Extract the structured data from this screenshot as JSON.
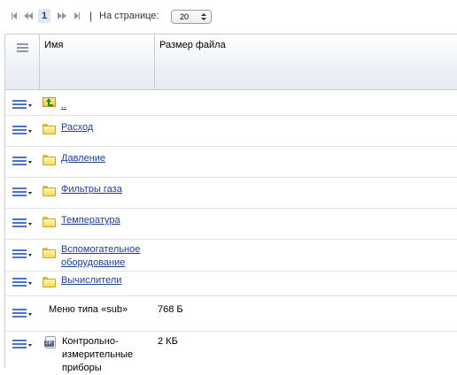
{
  "pager": {
    "current_page": "1",
    "separator": "|",
    "per_page_label": "На странице:",
    "per_page_value": "20"
  },
  "table": {
    "columns": [
      "Имя",
      "Размер файла"
    ],
    "rows": [
      {
        "type": "up",
        "name": "..",
        "size": ""
      },
      {
        "type": "folder",
        "name": "Расход",
        "size": ""
      },
      {
        "type": "folder",
        "name": "Давление",
        "size": ""
      },
      {
        "type": "folder",
        "name": "Фильтры газа",
        "size": ""
      },
      {
        "type": "folder",
        "name": "Температура",
        "size": ""
      },
      {
        "type": "folder",
        "name": "Вспомогательное оборудование",
        "size": ""
      },
      {
        "type": "folder",
        "name": "Вычислители",
        "size": ""
      },
      {
        "type": "menu",
        "name": "Меню типа «sub»",
        "size": "768 Б"
      },
      {
        "type": "zip",
        "name": "Контрольно-измерительные приборы",
        "size": "2 КБ"
      }
    ]
  },
  "colors": {
    "link": "#1f3e8f",
    "menu_icon": "#4b73c7",
    "folder": "#f3dc5a"
  },
  "icons": [
    "first-page-icon",
    "prev-page-icon",
    "next-page-icon",
    "last-page-icon",
    "row-menu-icon",
    "folder-icon",
    "up-folder-icon",
    "zip-file-icon"
  ]
}
